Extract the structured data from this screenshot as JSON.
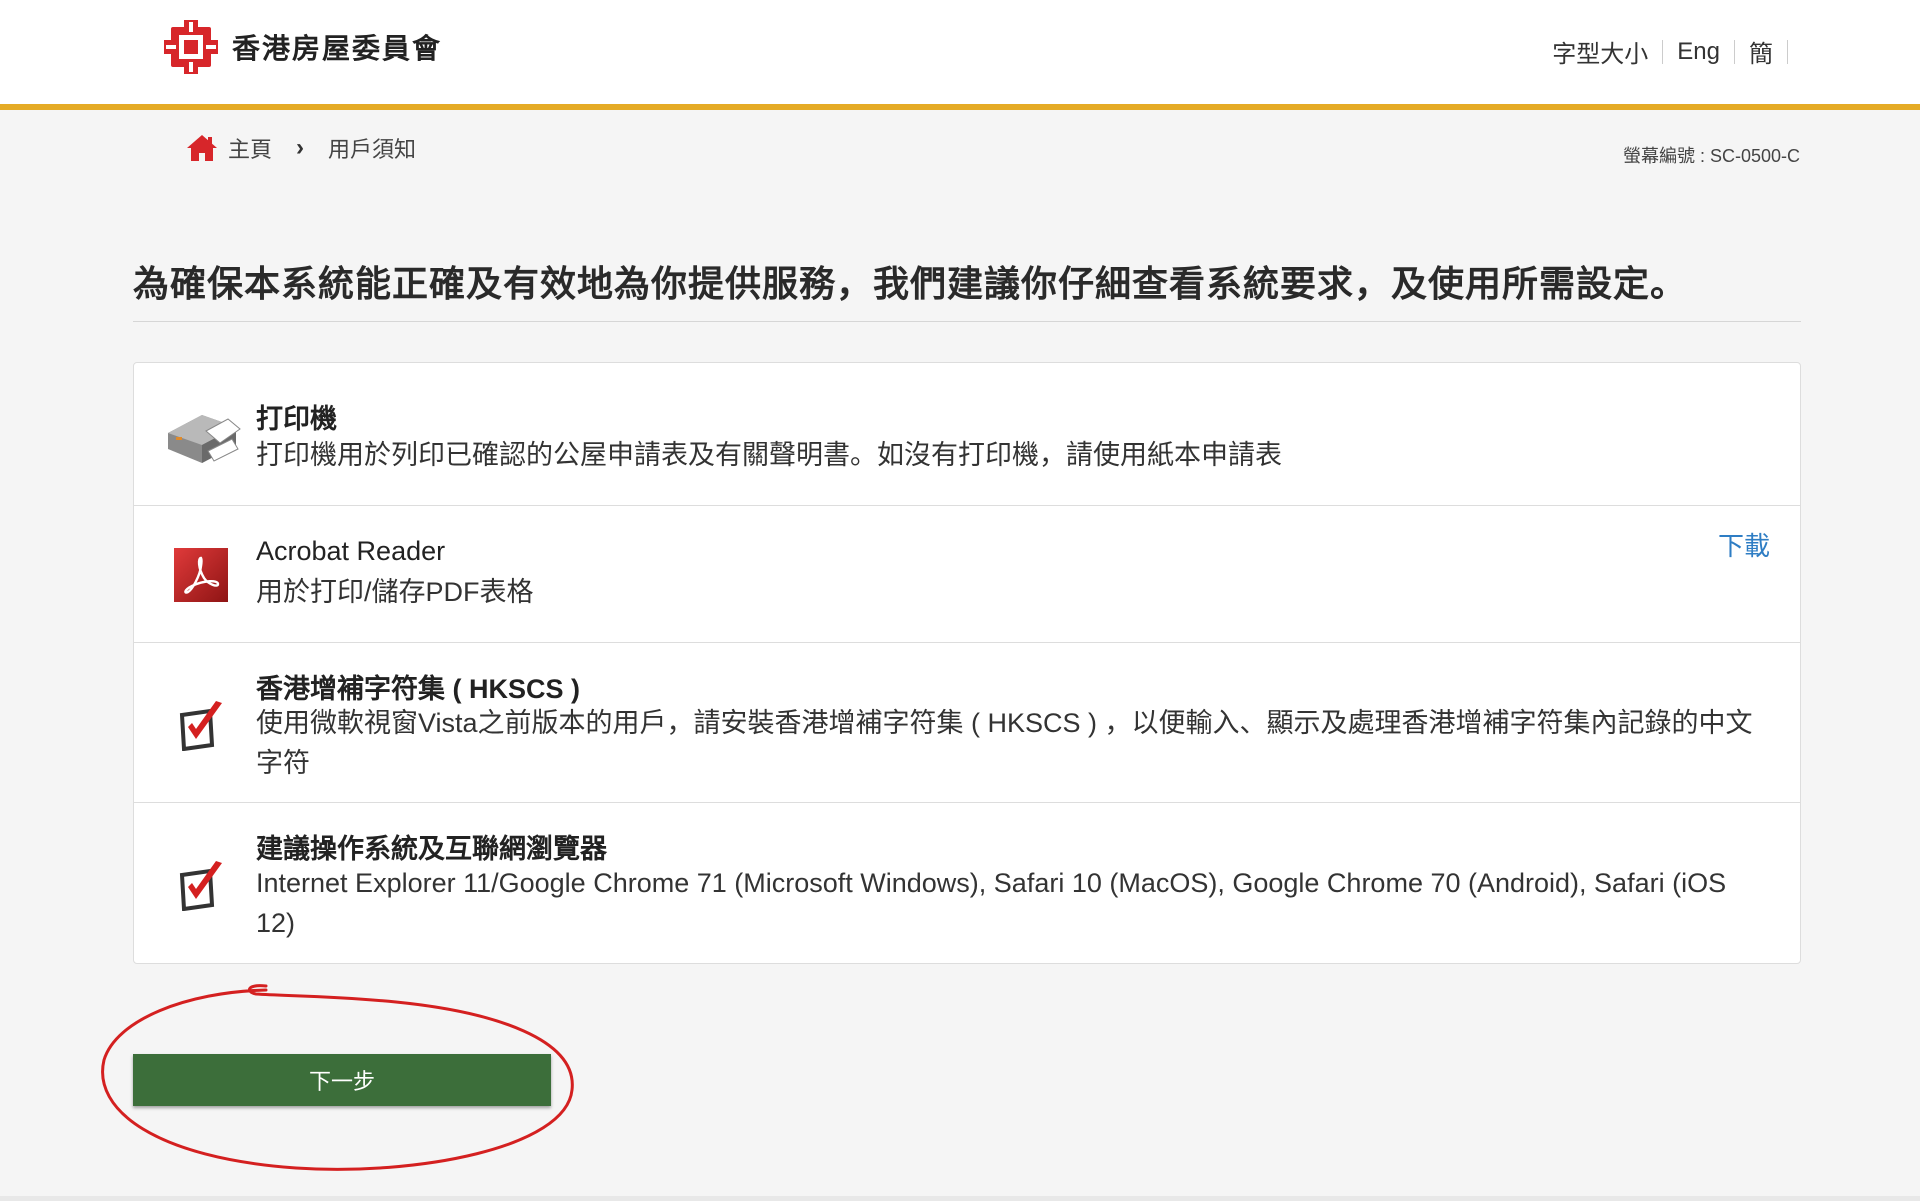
{
  "header": {
    "org_name": "香港房屋委員會",
    "font_size_label": "字型大小",
    "lang_en": "Eng",
    "lang_sc": "簡",
    "accent_color": "#e5ab26",
    "logo_color": "#d7262a"
  },
  "breadcrumb": {
    "home": "主頁",
    "current": "用戶須知"
  },
  "screen_no": "螢幕編號 : SC-0500-C",
  "page_title": "為確保本系統能正確及有效地為你提供服務，我們建議你仔細查看系統要求，及使用所需設定。",
  "requirements": [
    {
      "icon": "printer-icon",
      "title": "打印機",
      "desc": "打印機用於列印已確認的公屋申請表及有關聲明書。如沒有打印機，請使用紙本申請表"
    },
    {
      "icon": "acrobat-icon",
      "title": "Acrobat Reader",
      "desc": "用於打印/儲存PDF表格",
      "link": "下載"
    },
    {
      "icon": "checkbox-icon",
      "title": "香港增補字符集 ( HKSCS )",
      "desc": "使用微軟視窗Vista之前版本的用戶，請安裝香港增補字符集 ( HKSCS ) ，以便輸入、顯示及處理香港增補字符集內記錄的中文字符"
    },
    {
      "icon": "checkbox-icon",
      "title": "建議操作系統及互聯網瀏覽器",
      "desc": "Internet Explorer 11/Google Chrome 71 (Microsoft Windows), Safari 10 (MacOS), Google Chrome 70 (Android), Safari (iOS 12)"
    }
  ],
  "next_button": "下一步",
  "colors": {
    "link": "#2e7dc4",
    "button": "#3c6e3a",
    "annotation": "#d42020"
  }
}
